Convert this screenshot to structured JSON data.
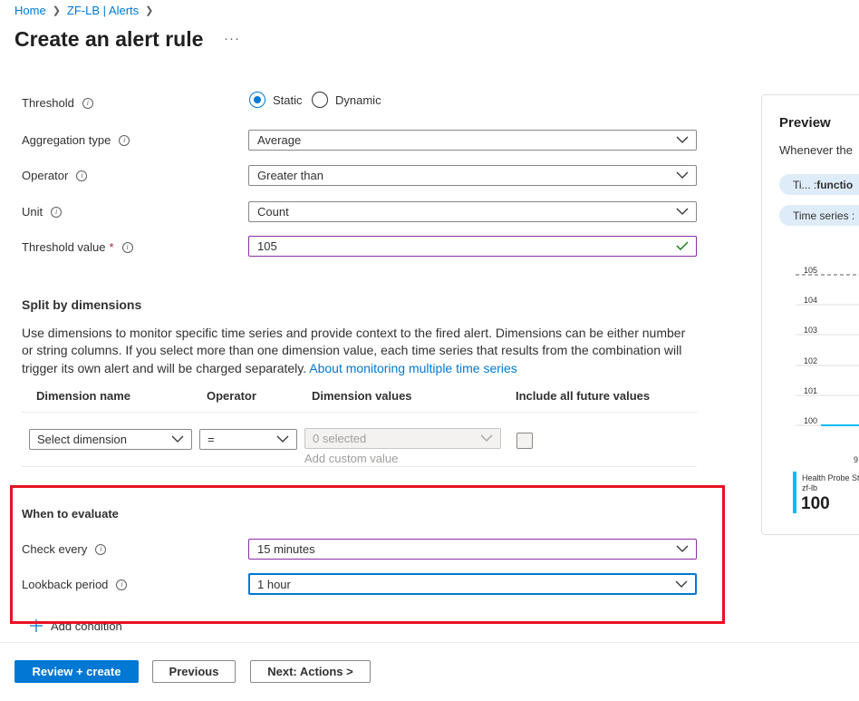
{
  "breadcrumb": [
    "Home",
    "ZF-LB | Alerts"
  ],
  "title": "Create an alert rule",
  "more_label": "···",
  "form": {
    "threshold": {
      "label": "Threshold",
      "options": [
        "Static",
        "Dynamic"
      ],
      "selected": "Static"
    },
    "aggregation_type": {
      "label": "Aggregation type",
      "value": "Average"
    },
    "operator": {
      "label": "Operator",
      "value": "Greater than"
    },
    "unit": {
      "label": "Unit",
      "value": "Count"
    },
    "threshold_value": {
      "label": "Threshold value",
      "required_mark": "*",
      "value": "105"
    }
  },
  "split": {
    "title": "Split by dimensions",
    "description": "Use dimensions to monitor specific time series and provide context to the fired alert. Dimensions can be either number or string columns. If you select more than one dimension value, each time series that results from the combination will trigger its own alert and will be charged separately.",
    "link": "About monitoring multiple time series",
    "columns": [
      "Dimension name",
      "Operator",
      "Dimension values",
      "Include all future values"
    ],
    "row": {
      "dimension_name": "Select dimension",
      "operator": "=",
      "dimension_values": "0 selected",
      "add_custom": "Add custom value"
    }
  },
  "evaluate": {
    "title": "When to evaluate",
    "check_every": {
      "label": "Check every",
      "value": "15 minutes"
    },
    "lookback": {
      "label": "Lookback period",
      "value": "1 hour"
    }
  },
  "add_condition": "Add condition",
  "buttons": {
    "review": "Review + create",
    "previous": "Previous",
    "next": "Next: Actions >"
  },
  "preview": {
    "title": "Preview",
    "whenever": "Whenever the",
    "pill1_prefix": "Ti... : ",
    "pill1_bold": "functio",
    "pill2": "Time series :",
    "legend_name": "Health Probe St",
    "legend_resource": "zf-lb",
    "legend_value": "100",
    "x_tick": "9"
  },
  "chart_data": {
    "type": "line",
    "y_ticks": [
      "105",
      "104",
      "103",
      "102",
      "101",
      "100"
    ],
    "threshold": 105,
    "series": [
      {
        "values": [
          100,
          100
        ]
      }
    ]
  },
  "colors": {
    "accent": "#0078d4",
    "highlight": "#e81123",
    "focus_purple": "#8a2da5",
    "series": "#00bcf2"
  }
}
